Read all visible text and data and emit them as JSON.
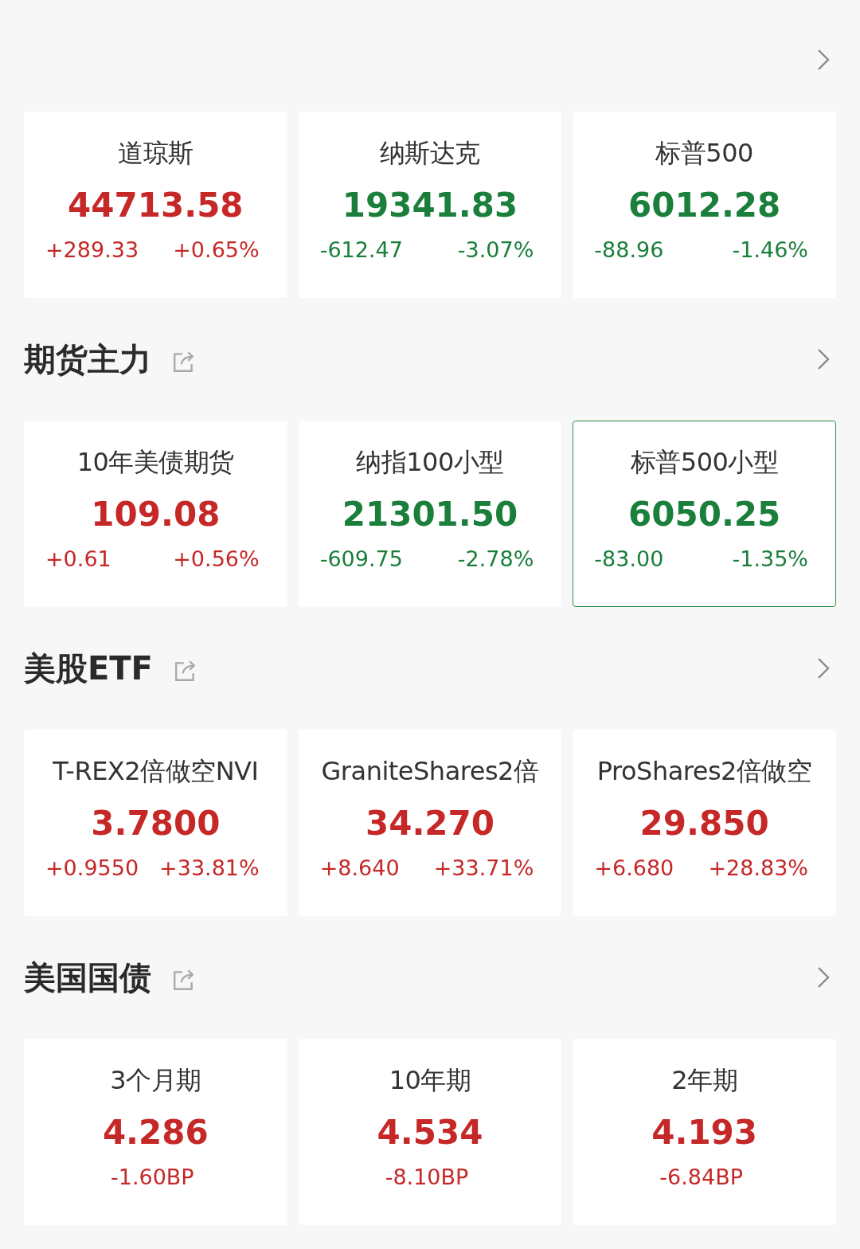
{
  "sections": [
    {
      "cards": [
        {
          "name": "道琼斯",
          "price": "44713.58",
          "color": "#c62828",
          "selected": false,
          "changes": [
            "+289.33",
            "+0.65%"
          ]
        },
        {
          "name": "纳斯达克",
          "price": "19341.83",
          "color": "#1b7f3c",
          "selected": false,
          "changes": [
            "-612.47",
            "-3.07%"
          ]
        },
        {
          "name": "标普500",
          "price": "6012.28",
          "color": "#1b7f3c",
          "selected": false,
          "changes": [
            "-88.96",
            "-1.46%"
          ]
        }
      ]
    },
    {
      "title": "期货主力",
      "cards": [
        {
          "name": "10年美债期货",
          "price": "109.08",
          "color": "#c62828",
          "selected": false,
          "changes": [
            "+0.61",
            "+0.56%"
          ]
        },
        {
          "name": "纳指100小型",
          "price": "21301.50",
          "color": "#1b7f3c",
          "selected": false,
          "changes": [
            "-609.75",
            "-2.78%"
          ]
        },
        {
          "name": "标普500小型",
          "price": "6050.25",
          "color": "#1b7f3c",
          "selected": true,
          "changes": [
            "-83.00",
            "-1.35%"
          ]
        }
      ]
    },
    {
      "title": "美股ETF",
      "cards": [
        {
          "name": "T-REX2倍做空NVI",
          "price": "3.7800",
          "color": "#c62828",
          "selected": false,
          "changes": [
            "+0.9550",
            "+33.81%"
          ]
        },
        {
          "name": "GraniteShares2倍",
          "price": "34.270",
          "color": "#c62828",
          "selected": false,
          "changes": [
            "+8.640",
            "+33.71%"
          ]
        },
        {
          "name": "ProShares2倍做空",
          "price": "29.850",
          "color": "#c62828",
          "selected": false,
          "changes": [
            "+6.680",
            "+28.83%"
          ]
        }
      ]
    },
    {
      "title": "美国国债",
      "cards": [
        {
          "name": "3个月期",
          "price": "4.286",
          "color": "#c62828",
          "selected": false,
          "changes": [
            "-1.60BP"
          ]
        },
        {
          "name": "10年期",
          "price": "4.534",
          "color": "#c62828",
          "selected": false,
          "changes": [
            "-8.10BP"
          ]
        },
        {
          "name": "2年期",
          "price": "4.193",
          "color": "#c62828",
          "selected": false,
          "changes": [
            "-6.84BP"
          ]
        }
      ]
    }
  ]
}
